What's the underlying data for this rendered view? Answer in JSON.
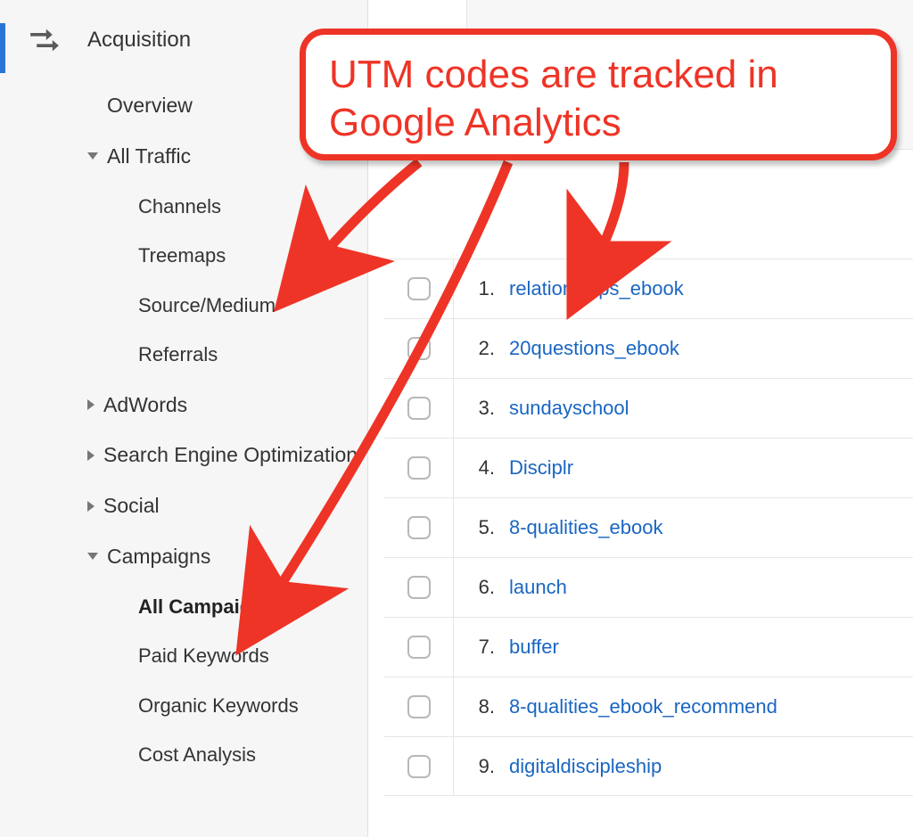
{
  "sidebar": {
    "section_label": "Acquisition",
    "items": [
      {
        "label": "Overview",
        "type": "plain"
      },
      {
        "label": "All Traffic",
        "type": "expanded"
      },
      {
        "label": "Channels",
        "type": "sub"
      },
      {
        "label": "Treemaps",
        "type": "sub"
      },
      {
        "label": "Source/Medium",
        "type": "sub"
      },
      {
        "label": "Referrals",
        "type": "sub"
      },
      {
        "label": "AdWords",
        "type": "collapsed"
      },
      {
        "label": "Search Engine Optimization",
        "type": "collapsed"
      },
      {
        "label": "Social",
        "type": "collapsed"
      },
      {
        "label": "Campaigns",
        "type": "expanded"
      },
      {
        "label": "All Campaigns",
        "type": "sub-bold"
      },
      {
        "label": "Paid Keywords",
        "type": "sub"
      },
      {
        "label": "Organic Keywords",
        "type": "sub"
      },
      {
        "label": "Cost Analysis",
        "type": "sub"
      }
    ]
  },
  "table": {
    "rows": [
      {
        "num": "1.",
        "label": "relationships_ebook"
      },
      {
        "num": "2.",
        "label": "20questions_ebook"
      },
      {
        "num": "3.",
        "label": "sundayschool"
      },
      {
        "num": "4.",
        "label": "Disciplr"
      },
      {
        "num": "5.",
        "label": "8-qualities_ebook"
      },
      {
        "num": "6.",
        "label": "launch"
      },
      {
        "num": "7.",
        "label": "buffer"
      },
      {
        "num": "8.",
        "label": "8-qualities_ebook_recommend"
      },
      {
        "num": "9.",
        "label": "digitaldiscipleship"
      }
    ]
  },
  "annotation": {
    "text": "UTM codes are tracked in Google Analytics"
  }
}
